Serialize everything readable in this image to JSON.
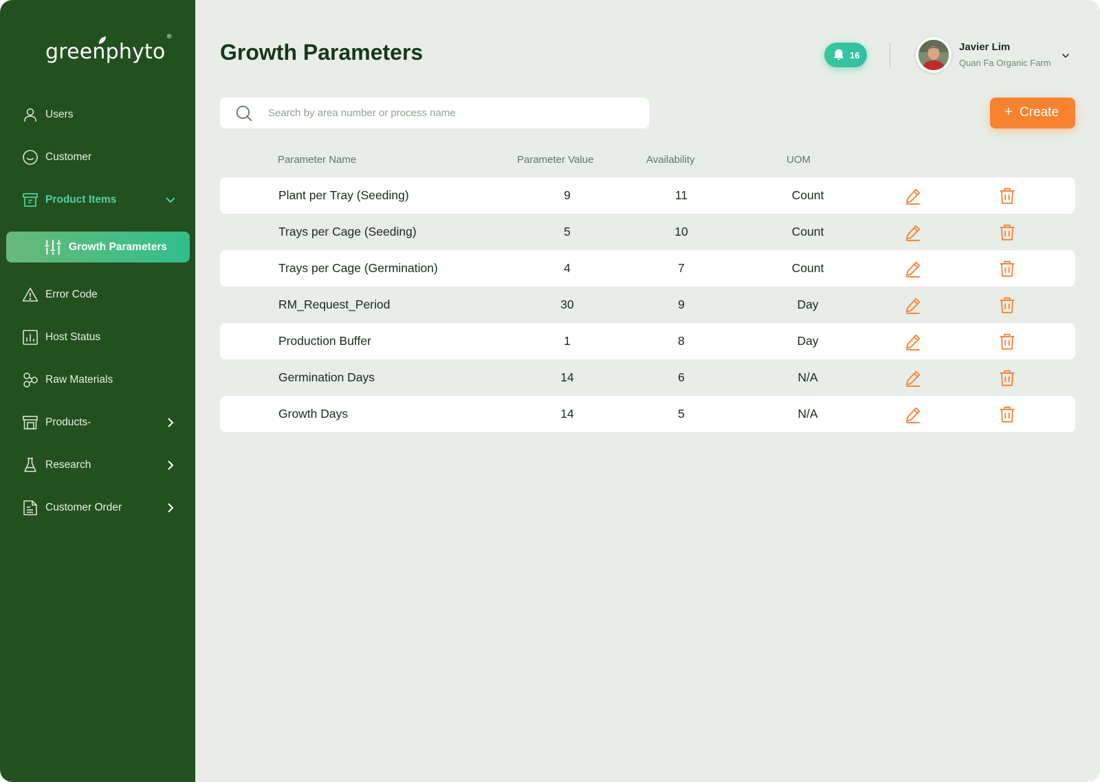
{
  "brand": {
    "name": "greenphyto",
    "registered": "®"
  },
  "sidebar": {
    "items": [
      {
        "label": "Users",
        "icon": "user-icon"
      },
      {
        "label": "Customer",
        "icon": "smile-icon"
      },
      {
        "label": "Product Items",
        "icon": "archive-box-icon",
        "expanded": true
      },
      {
        "label": "Growth Parameters",
        "icon": "sliders-icon",
        "active": true
      },
      {
        "label": "Error Code",
        "icon": "warning-icon"
      },
      {
        "label": "Host Status",
        "icon": "bar-chart-icon"
      },
      {
        "label": "Raw Materials",
        "icon": "molecule-icon"
      },
      {
        "label": "Products-",
        "icon": "boxes-icon",
        "has_children": true
      },
      {
        "label": "Research",
        "icon": "flask-icon",
        "has_children": true
      },
      {
        "label": "Customer Order",
        "icon": "document-icon",
        "has_children": true
      }
    ]
  },
  "header": {
    "title": "Growth Parameters",
    "notifications": {
      "count": "16",
      "icon": "bell-icon"
    },
    "user": {
      "name": "Javier Lim",
      "organization": "Quan Fa Organic Farm"
    }
  },
  "search": {
    "placeholder": "Search by area number or process name",
    "value": ""
  },
  "create_button": {
    "label": "Create",
    "icon": "+"
  },
  "table": {
    "columns": [
      "Parameter Name",
      "Parameter Value",
      "Availability",
      "UOM"
    ],
    "rows": [
      {
        "name": "Plant per Tray (Seeding)",
        "value": "9",
        "availability": "11",
        "uom": "Count"
      },
      {
        "name": "Trays per Cage (Seeding)",
        "value": "5",
        "availability": "10",
        "uom": "Count"
      },
      {
        "name": "Trays per Cage (Germination)",
        "value": "4",
        "availability": "7",
        "uom": "Count"
      },
      {
        "name": "RM_Request_Period",
        "value": "30",
        "availability": "9",
        "uom": "Day"
      },
      {
        "name": "Production Buffer",
        "value": "1",
        "availability": "8",
        "uom": "Day"
      },
      {
        "name": "Germination Days",
        "value": "14",
        "availability": "6",
        "uom": "N/A"
      },
      {
        "name": "Growth Days",
        "value": "14",
        "availability": "5",
        "uom": "N/A"
      }
    ]
  },
  "colors": {
    "sidebar": "#23501f",
    "accent_green": "#2fbf8a",
    "accent_orange": "#f7822f",
    "background": "#e8ede7"
  }
}
